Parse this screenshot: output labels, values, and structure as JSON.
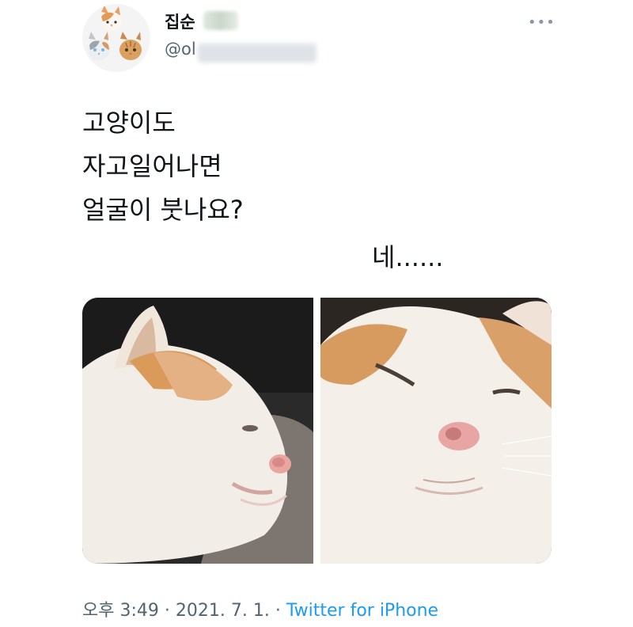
{
  "author": {
    "display_name_visible": "집순",
    "handle_visible": "@ol"
  },
  "tweet": {
    "lines": [
      "고양이도",
      "자고일어나면",
      "얼굴이 붓나요?"
    ],
    "reply_text": "네......"
  },
  "meta": {
    "time": "오후 3:49",
    "separator1": "·",
    "date": "2021. 7. 1.",
    "separator2": "·",
    "source": "Twitter for iPhone"
  },
  "icons": {
    "more": "more-horizontal-icon",
    "avatar": "cat-avatar-icon"
  },
  "colors": {
    "link": "#1d9bf0",
    "secondary_text": "#536471",
    "primary_text": "#0f1419"
  }
}
